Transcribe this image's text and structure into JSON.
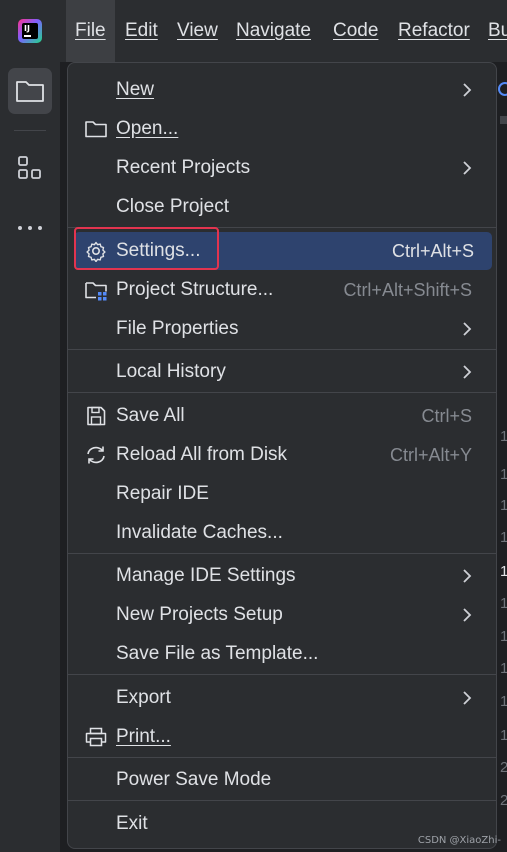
{
  "menubar": {
    "items": [
      {
        "label": "File",
        "mnemonic_index": 0
      },
      {
        "label": "Edit",
        "mnemonic_index": 0
      },
      {
        "label": "View",
        "mnemonic_index": 0
      },
      {
        "label": "Navigate",
        "mnemonic_index": 0
      },
      {
        "label": "Code",
        "mnemonic_index": 0
      },
      {
        "label": "Refactor",
        "mnemonic_index": 0
      },
      {
        "label": "Bu"
      }
    ]
  },
  "file_menu": {
    "items": [
      {
        "label": "New"
      },
      {
        "label": "Open..."
      },
      {
        "label": "Recent Projects"
      },
      {
        "label": "Close Project"
      },
      {
        "label": "Settings...",
        "shortcut": "Ctrl+Alt+S"
      },
      {
        "label": "Project Structure...",
        "shortcut": "Ctrl+Alt+Shift+S"
      },
      {
        "label": "File Properties"
      },
      {
        "label": "Local History"
      },
      {
        "label": "Save All",
        "shortcut": "Ctrl+S"
      },
      {
        "label": "Reload All from Disk",
        "shortcut": "Ctrl+Alt+Y"
      },
      {
        "label": "Repair IDE"
      },
      {
        "label": "Invalidate Caches..."
      },
      {
        "label": "Manage IDE Settings"
      },
      {
        "label": "New Projects Setup"
      },
      {
        "label": "Save File as Template..."
      },
      {
        "label": "Export"
      },
      {
        "label": "Print..."
      },
      {
        "label": "Power Save Mode"
      },
      {
        "label": "Exit"
      }
    ]
  },
  "icons": {
    "logo": "intellij-idea-logo",
    "project_tool": "folder-icon",
    "structure_tool": "structure-icon",
    "more": "more-icon",
    "open": "folder-icon",
    "settings": "gear-icon",
    "project_structure": "project-structure-icon",
    "save_all": "save-icon",
    "reload": "reload-icon",
    "print": "printer-icon",
    "submenu": "chevron-right-icon"
  },
  "gutter": {
    "line_numbers": [
      "1",
      "1",
      "1",
      "1",
      "1",
      "1",
      "1",
      "1",
      "1",
      "1",
      "2",
      "2"
    ]
  },
  "watermark": "CSDN @XiaoZhi-",
  "colors": {
    "background": "#1e1f22",
    "menu_background": "#2b2d30",
    "selection": "#2e436e",
    "highlight_box": "#e2344f",
    "text": "#dfe1e5",
    "shortcut_text": "#868a91"
  }
}
